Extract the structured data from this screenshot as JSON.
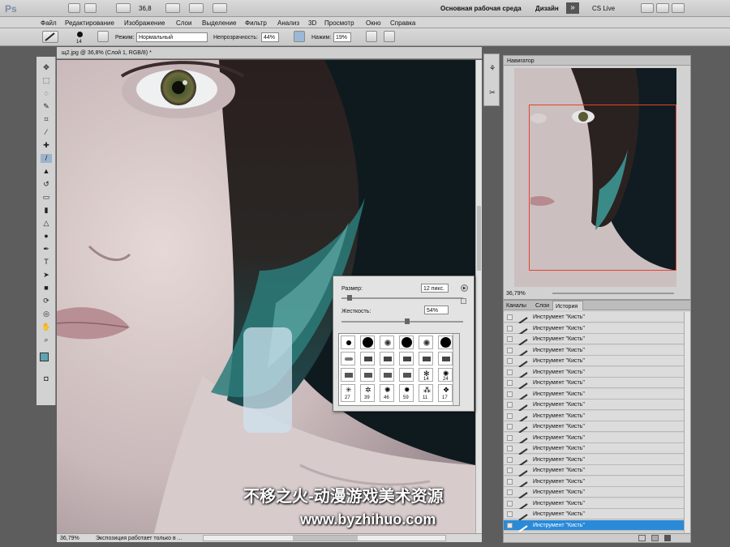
{
  "app": {
    "logo": "Ps",
    "zoom_level": "36,8"
  },
  "topbar": {
    "workspace": "Основная рабочая среда",
    "design": "Дизайн",
    "more": "»",
    "cslive": "CS Live"
  },
  "menu": [
    "Файл",
    "Редактирование",
    "Изображение",
    "Слои",
    "Выделение",
    "Фильтр",
    "Анализ",
    "3D",
    "Просмотр",
    "Окно",
    "Справка"
  ],
  "options": {
    "brush_size": "14",
    "mode_label": "Режим:",
    "mode_value": "Нормальный",
    "opacity_label": "Непрозрачность:",
    "opacity_value": "44%",
    "flow_label": "Нажим:",
    "flow_value": "19%"
  },
  "document": {
    "tab_title": "щ2.jpg @ 36,8% (Слой 1, RGB/8) *",
    "zoom": "36,79%",
    "status": "Экспозиция работает только в ..."
  },
  "brush_popup": {
    "size_label": "Размер:",
    "size_value": "12 пикс.",
    "hardness_label": "Жесткость:",
    "hardness_value": "54%",
    "size_fraction": 0.05,
    "hardness_fraction": 0.54,
    "presets_row3": [
      "",
      "",
      "",
      "",
      "14",
      "24"
    ],
    "presets_row4": [
      "27",
      "39",
      "46",
      "59",
      "11",
      "17"
    ]
  },
  "navigator": {
    "title": "Навигатор",
    "zoom": "36,79%"
  },
  "history": {
    "tabs": [
      "Каналы",
      "Слои",
      "История"
    ],
    "items": [
      "Инструмент \"Кисть\"",
      "Инструмент \"Кисть\"",
      "Инструмент \"Кисть\"",
      "Инструмент \"Кисть\"",
      "Инструмент \"Кисть\"",
      "Инструмент \"Кисть\"",
      "Инструмент \"Кисть\"",
      "Инструмент \"Кисть\"",
      "Инструмент \"Кисть\"",
      "Инструмент \"Кисть\"",
      "Инструмент \"Кисть\"",
      "Инструмент \"Кисть\"",
      "Инструмент \"Кисть\"",
      "Инструмент \"Кисть\"",
      "Инструмент \"Кисть\"",
      "Инструмент \"Кисть\"",
      "Инструмент \"Кисть\"",
      "Инструмент \"Кисть\"",
      "Инструмент \"Кисть\"",
      "Инструмент \"Кисть\""
    ]
  },
  "watermark": {
    "line1": "不移之火-动漫游戏美术资源",
    "line2": "www.byzhihuo.com"
  },
  "colors": {
    "foreground": "#5fa3b0",
    "background": "#ffffff",
    "selection": "#2a8ad8"
  }
}
